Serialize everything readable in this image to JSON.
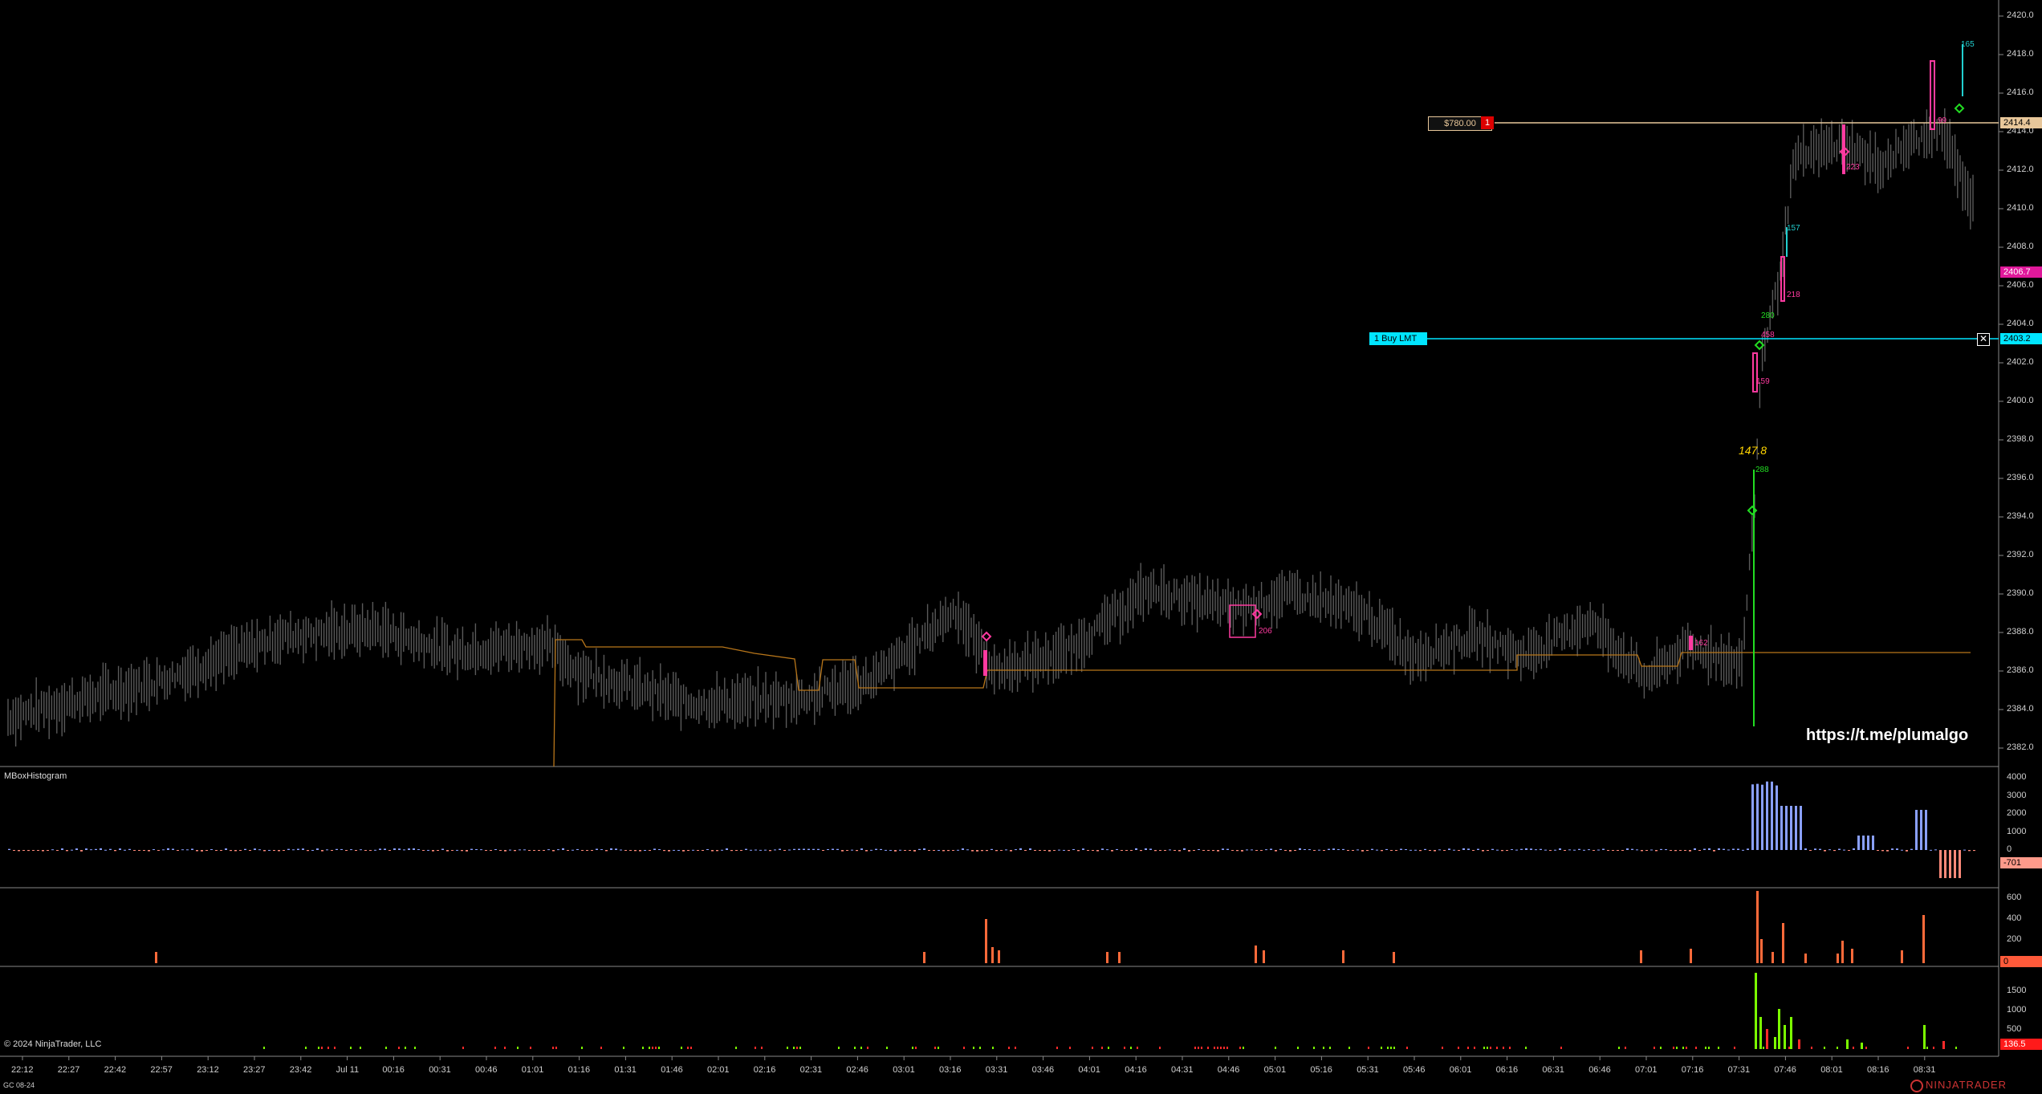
{
  "colors": {
    "background": "#000000",
    "axis_text": "#cfcfcf",
    "candle": "#5a5a5a",
    "orange_line": "#b8761a",
    "position_line": "#e8c79a",
    "buy_limit_line": "#00e5ff",
    "pink": "#ff3aa0",
    "green": "#22dd22",
    "cyan": "#22d0d0",
    "hist_pos": "#8aa0ff",
    "hist_neg": "#ff8a7a",
    "vol_orange": "#ff6a3a",
    "delta_green": "#7cff00",
    "delta_red": "#ff2a2a"
  },
  "price_axis": {
    "ticks": [
      "2420.0",
      "2418.0",
      "2416.0",
      "2414.0",
      "2412.0",
      "2410.0",
      "2408.0",
      "2406.0",
      "2404.0",
      "2402.0",
      "2400.0",
      "2398.0",
      "2396.0",
      "2394.0",
      "2392.0",
      "2390.0",
      "2388.0",
      "2386.0",
      "2384.0",
      "2382.0"
    ],
    "markers": {
      "position_price": "2414.4",
      "last_price": "2406.7",
      "limit_price": "2403.2"
    }
  },
  "position": {
    "pnl": "$780.00",
    "qty": "1"
  },
  "order": {
    "label": "1  Buy LMT",
    "close_icon": "close-icon"
  },
  "annotations": {
    "big_value": "147.8",
    "small_numbers": [
      "165",
      "223",
      "218",
      "157",
      "280",
      "458",
      "159",
      "288",
      "206",
      "162",
      "99"
    ]
  },
  "watermark": "https://t.me/plumalgo",
  "copyright": "© 2024 NinjaTrader, LLC",
  "instrument": "GC 08-24",
  "brand": "NINJATRADER",
  "panels": {
    "histogram": {
      "title": "MBoxHistogram",
      "ticks": [
        "4000",
        "3000",
        "2000",
        "1000",
        "0"
      ],
      "value_tag": "-701"
    },
    "volume": {
      "ticks": [
        "600",
        "400",
        "200"
      ],
      "value_tag": "0"
    },
    "delta": {
      "ticks": [
        "1500",
        "1000",
        "500"
      ],
      "value_tag": "136.5"
    }
  },
  "time_axis": {
    "ticks": [
      "22:12",
      "22:27",
      "22:42",
      "22:57",
      "23:12",
      "23:27",
      "23:42",
      "Jul 11",
      "00:16",
      "00:31",
      "00:46",
      "01:01",
      "01:16",
      "01:31",
      "01:46",
      "02:01",
      "02:16",
      "02:31",
      "02:46",
      "03:01",
      "03:16",
      "03:31",
      "03:46",
      "04:01",
      "04:16",
      "04:31",
      "04:46",
      "05:01",
      "05:16",
      "05:31",
      "05:46",
      "06:01",
      "06:16",
      "06:31",
      "06:46",
      "07:01",
      "07:16",
      "07:31",
      "07:46",
      "08:01",
      "08:16",
      "08:31"
    ]
  }
}
